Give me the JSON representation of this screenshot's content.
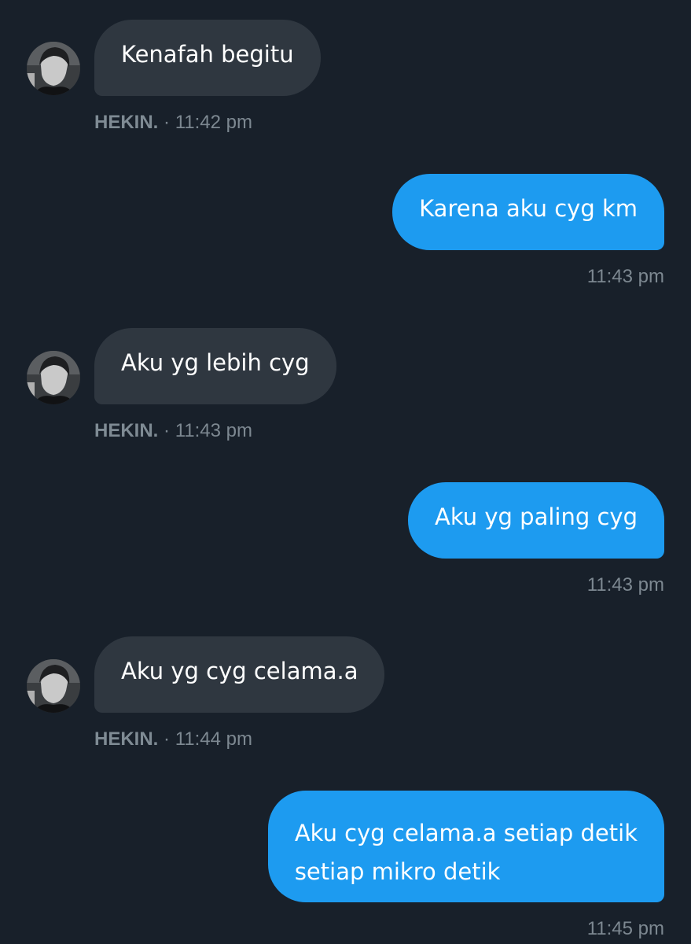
{
  "colors": {
    "background": "#18202a",
    "incoming_bubble": "#2f3740",
    "outgoing_bubble": "#1d9bf0",
    "meta_text": "#7d8891"
  },
  "messages": [
    {
      "direction": "incoming",
      "text": "Kenafah begitu",
      "sender": "HEKIN.",
      "separator": "·",
      "time": "11:42 pm",
      "avatar_icon": "user-avatar-icon"
    },
    {
      "direction": "outgoing",
      "text": "Karena aku cyg km",
      "time": "11:43 pm"
    },
    {
      "direction": "incoming",
      "text": "Aku yg lebih cyg",
      "sender": "HEKIN.",
      "separator": "·",
      "time": "11:43 pm",
      "avatar_icon": "user-avatar-icon"
    },
    {
      "direction": "outgoing",
      "text": "Aku yg paling cyg",
      "time": "11:43 pm"
    },
    {
      "direction": "incoming",
      "text": "Aku yg cyg celama.a",
      "sender": "HEKIN.",
      "separator": "·",
      "time": "11:44 pm",
      "avatar_icon": "user-avatar-icon"
    },
    {
      "direction": "outgoing",
      "text_lines": [
        "Aku cyg celama.a setiap detik",
        "setiap mikro detik"
      ],
      "time": "11:45 pm"
    }
  ]
}
